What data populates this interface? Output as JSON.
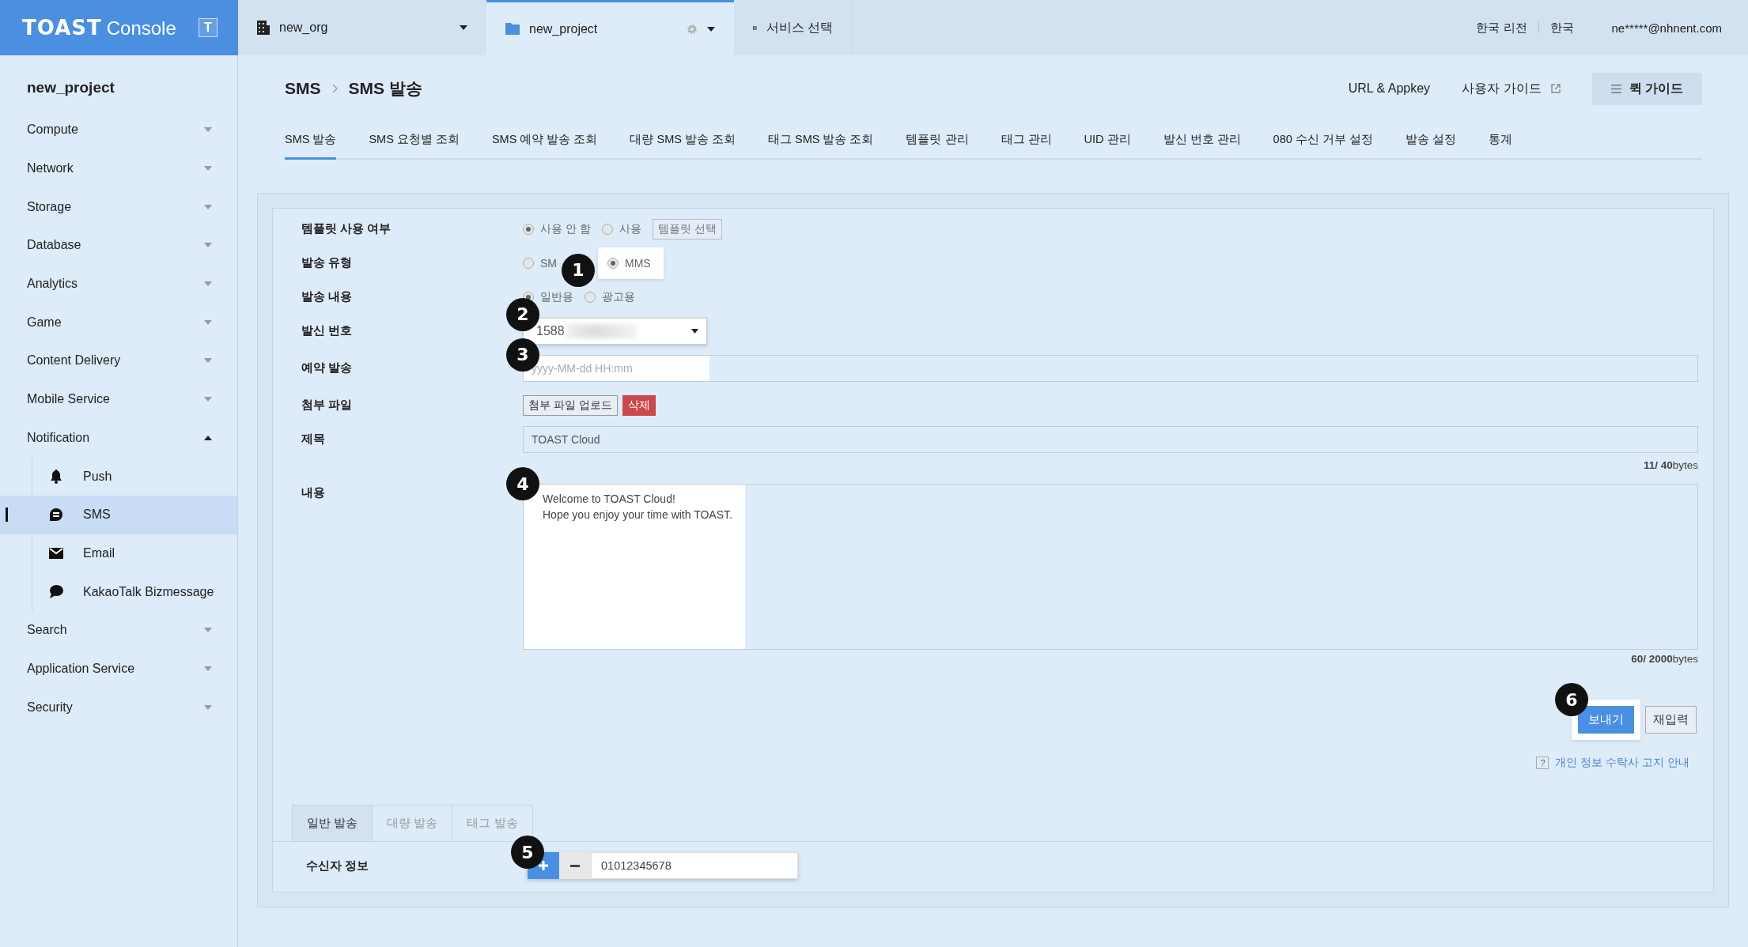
{
  "brand": {
    "logo": "TOAST",
    "product": "Console",
    "badge": "T"
  },
  "topbar": {
    "org": "new_org",
    "project": "new_project",
    "services": "서비스 선택",
    "region": "한국 리전",
    "language": "한국",
    "user": "ne*****@nhnent.com"
  },
  "sidebar": {
    "project": "new_project",
    "items": [
      {
        "label": "Compute",
        "expanded": false
      },
      {
        "label": "Network",
        "expanded": false
      },
      {
        "label": "Storage",
        "expanded": false
      },
      {
        "label": "Database",
        "expanded": false
      },
      {
        "label": "Analytics",
        "expanded": false
      },
      {
        "label": "Game",
        "expanded": false
      },
      {
        "label": "Content Delivery",
        "expanded": false
      },
      {
        "label": "Mobile Service",
        "expanded": false
      },
      {
        "label": "Notification",
        "expanded": true,
        "children": [
          {
            "label": "Push",
            "selected": false
          },
          {
            "label": "SMS",
            "selected": true
          },
          {
            "label": "Email",
            "selected": false
          },
          {
            "label": "KakaoTalk Bizmessage",
            "selected": false
          }
        ]
      },
      {
        "label": "Search",
        "expanded": false
      },
      {
        "label": "Application Service",
        "expanded": false
      },
      {
        "label": "Security",
        "expanded": false
      }
    ]
  },
  "header": {
    "breadcrumb": [
      "SMS",
      "SMS 발송"
    ],
    "appkey_link": "URL & Appkey",
    "guide_link": "사용자 가이드",
    "quick_guide": "퀵 가이드"
  },
  "tabs": [
    {
      "label": "SMS 발송",
      "selected": true
    },
    {
      "label": "SMS 요청별 조회",
      "selected": false
    },
    {
      "label": "SMS 예약 발송 조회",
      "selected": false
    },
    {
      "label": "대량 SMS 발송 조회",
      "selected": false
    },
    {
      "label": "태그 SMS 발송 조회",
      "selected": false
    },
    {
      "label": "템플릿 관리",
      "selected": false
    },
    {
      "label": "태그 관리",
      "selected": false
    },
    {
      "label": "UID 관리",
      "selected": false
    },
    {
      "label": "발신 번호 관리",
      "selected": false
    },
    {
      "label": "080 수신 거부 설정",
      "selected": false
    },
    {
      "label": "발송 설정",
      "selected": false
    },
    {
      "label": "통계",
      "selected": false
    }
  ],
  "form": {
    "template": {
      "label": "템플릿 사용 여부",
      "options": [
        {
          "label": "사용 안 함",
          "selected": true,
          "highlighted": false
        },
        {
          "label": "사용",
          "selected": false,
          "highlighted": false
        }
      ],
      "button": "템플릿 선택"
    },
    "send_type": {
      "label": "발송 유형",
      "options": [
        {
          "label": "SM",
          "selected": false,
          "highlighted": false
        },
        {
          "label": "MMS",
          "selected": true,
          "highlighted": true,
          "callout": "1"
        }
      ]
    },
    "content_type": {
      "label": "발송 내용",
      "options": [
        {
          "label": "일반용",
          "selected": true,
          "highlighted": false
        },
        {
          "label": "광고용",
          "selected": false,
          "highlighted": false
        }
      ]
    },
    "sender": {
      "label": "발신 번호",
      "value": "1588",
      "highlighted": true,
      "callout": "2"
    },
    "reservation": {
      "label": "예약 발송",
      "placeholder": "yyyy-MM-dd HH:mm",
      "highlighted": true,
      "callout": "3"
    },
    "attachment": {
      "label": "첨부 파일",
      "upload": "첨부 파일 업로드",
      "delete": "삭제"
    },
    "title": {
      "label": "제목",
      "value": "TOAST Cloud",
      "counter": "**11/ 40**bytes"
    },
    "message": {
      "label": "내용",
      "value": "Welcome to TOAST Cloud!\nHope you enjoy your time with TOAST.",
      "highlighted": true,
      "callout": "4",
      "counter": "**60/ 2000**bytes"
    },
    "actions": {
      "send": "보내기",
      "reset": "재입력",
      "highlighted": true,
      "callout": "6"
    },
    "privacy": {
      "mark": "?",
      "link": "개인 정보 수탁사 고지 안내"
    }
  },
  "recipient_tabs": [
    {
      "label": "일반 발송",
      "selected": true
    },
    {
      "label": "대량 발송",
      "selected": false
    },
    {
      "label": "태그 발송",
      "selected": false
    }
  ],
  "recipient": {
    "label": "수신자 정보",
    "value": "01012345678",
    "highlighted": true,
    "callout": "5"
  }
}
